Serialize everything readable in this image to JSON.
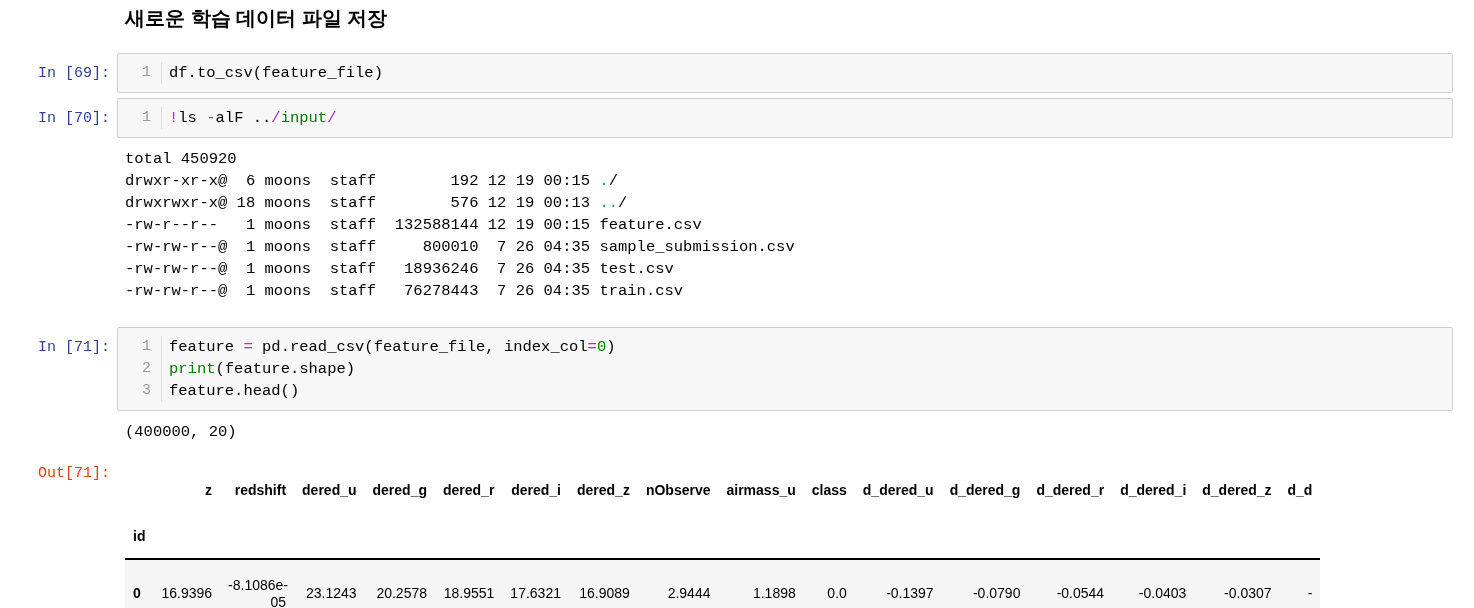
{
  "heading": "새로운 학습 데이터 파일 저장",
  "cells": [
    {
      "prompt": "In [69]:",
      "lines": [
        {
          "number": "1",
          "tokens": [
            {
              "text": "df.to_csv(feature_file)",
              "kind": "plain"
            }
          ]
        }
      ]
    },
    {
      "prompt": "In [70]:",
      "lines": [
        {
          "number": "1",
          "tokens": [
            {
              "text": "!",
              "kind": "operator"
            },
            {
              "text": "ls ",
              "kind": "plain"
            },
            {
              "text": "-",
              "kind": "operator"
            },
            {
              "text": "alF ..",
              "kind": "plain"
            },
            {
              "text": "/",
              "kind": "operator"
            },
            {
              "text": "input",
              "kind": "builtin"
            },
            {
              "text": "/",
              "kind": "operator"
            }
          ]
        }
      ],
      "output": {
        "kind": "stream",
        "lines": [
          [
            {
              "text": "total 450920",
              "kind": "plain"
            }
          ],
          [
            {
              "text": "drwxr-xr-x@  6 moons  staff        192 12 19 00:15 ",
              "kind": "plain"
            },
            {
              "text": ".",
              "kind": "dir"
            },
            {
              "text": "/",
              "kind": "plain"
            }
          ],
          [
            {
              "text": "drwxrwxr-x@ 18 moons  staff        576 12 19 00:13 ",
              "kind": "plain"
            },
            {
              "text": "..",
              "kind": "dir"
            },
            {
              "text": "/",
              "kind": "plain"
            }
          ],
          [
            {
              "text": "-rw-r--r--   1 moons  staff  132588144 12 19 00:15 feature.csv",
              "kind": "plain"
            }
          ],
          [
            {
              "text": "-rw-rw-r--@  1 moons  staff     800010  7 26 04:35 sample_submission.csv",
              "kind": "plain"
            }
          ],
          [
            {
              "text": "-rw-rw-r--@  1 moons  staff   18936246  7 26 04:35 test.csv",
              "kind": "plain"
            }
          ],
          [
            {
              "text": "-rw-rw-r--@  1 moons  staff   76278443  7 26 04:35 train.csv",
              "kind": "plain"
            }
          ]
        ]
      }
    },
    {
      "prompt": "In [71]:",
      "lines": [
        {
          "number": "1",
          "tokens": [
            {
              "text": "feature ",
              "kind": "plain"
            },
            {
              "text": "=",
              "kind": "operator"
            },
            {
              "text": " pd.read_csv(feature_file, index_col",
              "kind": "plain"
            },
            {
              "text": "=",
              "kind": "operator"
            },
            {
              "text": "0",
              "kind": "number"
            },
            {
              "text": ")",
              "kind": "plain"
            }
          ]
        },
        {
          "number": "2",
          "tokens": [
            {
              "text": "print",
              "kind": "builtin"
            },
            {
              "text": "(feature.shape)",
              "kind": "plain"
            }
          ]
        },
        {
          "number": "3",
          "tokens": [
            {
              "text": "feature.head()",
              "kind": "plain"
            }
          ]
        }
      ],
      "output": {
        "kind": "stream",
        "lines": [
          [
            {
              "text": "(400000, 20)",
              "kind": "plain"
            }
          ]
        ]
      },
      "result": {
        "prompt": "Out[71]:",
        "table": {
          "columns": [
            "z",
            "redshift",
            "dered_u",
            "dered_g",
            "dered_r",
            "dered_i",
            "dered_z",
            "nObserve",
            "airmass_u",
            "class",
            "d_dered_u",
            "d_dered_g",
            "d_dered_r",
            "d_dered_i",
            "d_dered_z",
            "d_d"
          ],
          "index_name": "id",
          "rows": [
            {
              "index": "0",
              "cells": [
                "16.9396",
                "-8.1086e-05",
                "23.1243",
                "20.2578",
                "18.9551",
                "17.6321",
                "16.9089",
                "2.9444",
                "1.1898",
                "0.0",
                "-0.1397",
                "-0.0790",
                "-0.0544",
                "-0.0403",
                "-0.0307",
                "-"
              ]
            }
          ]
        }
      }
    }
  ]
}
